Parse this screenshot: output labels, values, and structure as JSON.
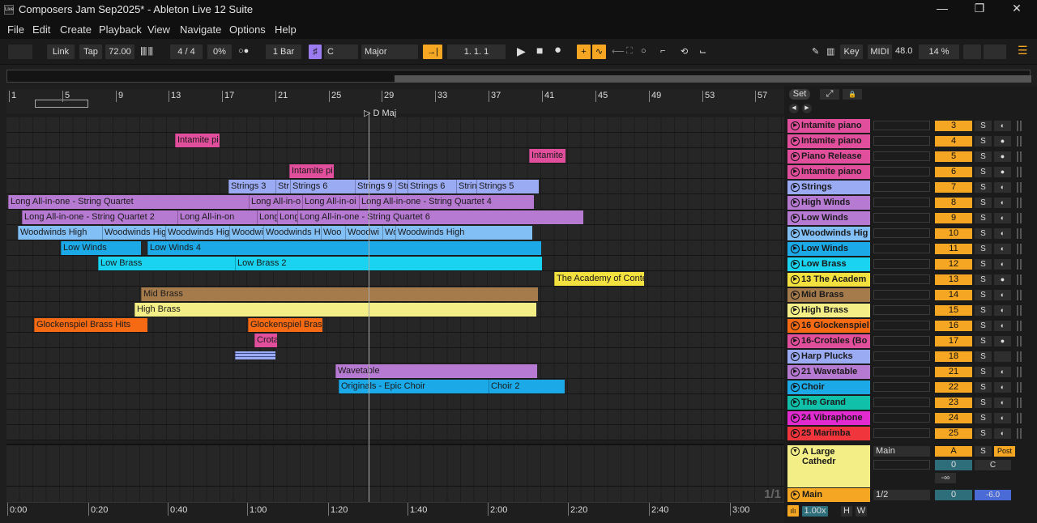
{
  "window": {
    "title": "Composers Jam Sep2025* - Ableton Live 12 Suite",
    "logo": "Live",
    "minimize": "—",
    "restore": "❐",
    "close": "✕"
  },
  "menu": [
    "File",
    "Edit",
    "Create",
    "Playback",
    "View",
    "Navigate",
    "Options",
    "Help"
  ],
  "toolbar": {
    "link": "Link",
    "tap": "Tap",
    "tempo": "72.00",
    "metronome_icon": "||||  |||",
    "time_sig": "4 / 4",
    "groove": "0%",
    "record_mode": "○●",
    "quantize": "1 Bar",
    "scale_root": "C",
    "scale_mode": "Major",
    "follow": "→|",
    "position": "1.   1.   1",
    "play": "▶",
    "stop": "■",
    "record": "●",
    "key": "Key",
    "midi": "MIDI",
    "cpu_value": "48.0",
    "zoom": "14 %"
  },
  "ruler": {
    "bars": [
      "1",
      "5",
      "9",
      "13",
      "17",
      "21",
      "25",
      "29",
      "33",
      "37",
      "41",
      "45",
      "49",
      "53",
      "57"
    ],
    "scale_marker": "D Maj"
  },
  "arrangement_lanes": [
    {
      "clips": []
    },
    {
      "clips": [
        {
          "name": "Intamite pi",
          "color": "#e14f9c"
        }
      ]
    },
    {
      "clips": [
        {
          "name": "Intamite",
          "color": "#e14f9c"
        }
      ]
    },
    {
      "clips": [
        {
          "name": "Intamite pi",
          "color": "#e14f9c"
        }
      ]
    },
    {
      "clips": [
        {
          "name": "Strings 3",
          "color": "#9aaaf3"
        },
        {
          "name": "Str",
          "color": "#9aaaf3"
        },
        {
          "name": "Strings 6",
          "color": "#9aaaf3"
        },
        {
          "name": "Strings 9",
          "color": "#9aaaf3"
        },
        {
          "name": "Str",
          "color": "#9aaaf3"
        },
        {
          "name": "Strings 6",
          "color": "#9aaaf3"
        },
        {
          "name": "Strin",
          "color": "#9aaaf3"
        },
        {
          "name": "Strings 5",
          "color": "#9aaaf3"
        }
      ]
    },
    {
      "clips": [
        {
          "name": "Long All-in-one - String Quartet",
          "color": "#b77ad3"
        },
        {
          "name": "Long All-in-o",
          "color": "#b77ad3"
        },
        {
          "name": "Long All-in-oi",
          "color": "#b77ad3"
        },
        {
          "name": "Long All-in-one - String Quartet 4",
          "color": "#b77ad3"
        }
      ]
    },
    {
      "clips": [
        {
          "name": "Long All-in-one - String Quartet 2",
          "color": "#b77ad3"
        },
        {
          "name": "Long All-in-on",
          "color": "#b77ad3"
        },
        {
          "name": "Long All-i",
          "color": "#b77ad3"
        },
        {
          "name": "Long",
          "color": "#b77ad3"
        },
        {
          "name": "Long All-in-one - String Quartet 6",
          "color": "#b77ad3"
        }
      ]
    },
    {
      "clips": [
        {
          "name": "Woodwinds High",
          "color": "#82bff5"
        },
        {
          "name": "Woodwinds Hig",
          "color": "#82bff5"
        },
        {
          "name": "Woodwinds High",
          "color": "#82bff5"
        },
        {
          "name": "Woodwi",
          "color": "#82bff5"
        },
        {
          "name": "Woodwinds Hi",
          "color": "#82bff5"
        },
        {
          "name": "Woo",
          "color": "#82bff5"
        },
        {
          "name": "Woodwi",
          "color": "#82bff5"
        },
        {
          "name": "Wo",
          "color": "#82bff5"
        },
        {
          "name": "Woodwinds High",
          "color": "#82bff5"
        }
      ]
    },
    {
      "clips": [
        {
          "name": "Low Winds",
          "color": "#1ba9e8"
        },
        {
          "name": "Low Winds 4",
          "color": "#1ba9e8"
        }
      ]
    },
    {
      "clips": [
        {
          "name": "Low Brass",
          "color": "#19d3f0"
        },
        {
          "name": "Low Brass 2",
          "color": "#19d3f0"
        }
      ]
    },
    {
      "clips": [
        {
          "name": "The Academy of Conte",
          "color": "#f3e13f"
        }
      ]
    },
    {
      "clips": [
        {
          "name": "Mid Brass",
          "color": "#a57b4c"
        }
      ]
    },
    {
      "clips": [
        {
          "name": "High Brass",
          "color": "#f3ef86"
        }
      ]
    },
    {
      "clips": [
        {
          "name": "Glockenspiel Brass Hits",
          "color": "#f66a14"
        },
        {
          "name": "Glockenspiel Brass",
          "color": "#f66a14"
        }
      ]
    },
    {
      "clips": [
        {
          "name": "Crota",
          "color": "#e14f9c"
        }
      ]
    },
    {
      "clips": [
        {
          "name": "",
          "color": "#9aaaf3"
        }
      ]
    },
    {
      "clips": [
        {
          "name": "Wavetable",
          "color": "#b77ad3"
        }
      ]
    },
    {
      "clips": [
        {
          "name": "Originals - Epic Choir",
          "color": "#1ba9e8"
        },
        {
          "name": "Choir 2",
          "color": "#1ba9e8"
        }
      ]
    },
    {
      "clips": []
    },
    {
      "clips": []
    },
    {
      "clips": []
    },
    {
      "clips": []
    }
  ],
  "set_controls": {
    "set": "Set",
    "expand": "⤢",
    "lock": "🔒",
    "back": "◀",
    "forward": "▶"
  },
  "tracks": [
    {
      "name": "Intamite piano",
      "color": "#e14f9c",
      "num": "3",
      "solo": "S",
      "arm": "◐"
    },
    {
      "name": "Intamite piano",
      "color": "#e14f9c",
      "num": "4",
      "solo": "S",
      "arm": "●"
    },
    {
      "name": "Piano Release",
      "color": "#e14f9c",
      "num": "5",
      "solo": "S",
      "arm": "●"
    },
    {
      "name": "Intamite piano",
      "color": "#e14f9c",
      "num": "6",
      "solo": "S",
      "arm": "●"
    },
    {
      "name": "Strings",
      "color": "#9aaaf3",
      "num": "7",
      "solo": "S",
      "arm": "◐"
    },
    {
      "name": "High Winds",
      "color": "#b77ad3",
      "num": "8",
      "solo": "S",
      "arm": "◐"
    },
    {
      "name": "Low Winds",
      "color": "#b77ad3",
      "num": "9",
      "solo": "S",
      "arm": "◐"
    },
    {
      "name": "Woodwinds Hig",
      "color": "#82bff5",
      "num": "10",
      "solo": "S",
      "arm": "◐"
    },
    {
      "name": "Low Winds",
      "color": "#1ba9e8",
      "num": "11",
      "solo": "S",
      "arm": "◐"
    },
    {
      "name": "Low Brass",
      "color": "#19d3f0",
      "num": "12",
      "solo": "S",
      "arm": "◐"
    },
    {
      "name": "13 The Academ",
      "color": "#f3e13f",
      "num": "13",
      "solo": "S",
      "arm": "●"
    },
    {
      "name": "Mid Brass",
      "color": "#a57b4c",
      "num": "14",
      "solo": "S",
      "arm": "◐"
    },
    {
      "name": "High Brass",
      "color": "#f3ef86",
      "num": "15",
      "solo": "S",
      "arm": "◐"
    },
    {
      "name": "16 Glockenspiel",
      "color": "#f66a14",
      "num": "16",
      "solo": "S",
      "arm": "◐"
    },
    {
      "name": "16-Crotales (Bo",
      "color": "#e14f9c",
      "num": "17",
      "solo": "S",
      "arm": "●"
    },
    {
      "name": "Harp Plucks",
      "color": "#9aaaf3",
      "num": "18",
      "solo": "S",
      "arm": ""
    },
    {
      "name": "21 Wavetable",
      "color": "#b77ad3",
      "num": "21",
      "solo": "S",
      "arm": "◐"
    },
    {
      "name": "Choir",
      "color": "#1ba9e8",
      "num": "22",
      "solo": "S",
      "arm": "◐"
    },
    {
      "name": "The Grand",
      "color": "#10c0a8",
      "num": "23",
      "solo": "S",
      "arm": "◐"
    },
    {
      "name": "24 Vibraphone",
      "color": "#e12bd0",
      "num": "24",
      "solo": "S",
      "arm": "◐"
    },
    {
      "name": "25 Marimba",
      "color": "#f0363c",
      "num": "25",
      "solo": "S",
      "arm": "◐"
    }
  ],
  "return_track": {
    "name": "A Large Cathedr",
    "color": "#f3ef86",
    "routing": "Main",
    "send_label": "A",
    "solo": "S",
    "post": "Post",
    "volume": "0",
    "pan": "C",
    "send_value": "-∞"
  },
  "main_track": {
    "name": "Main",
    "color": "#f5a623",
    "routing": "1/2",
    "volume": "0",
    "level": "-6.0"
  },
  "footer": {
    "page": "1/1",
    "zoom": "1.00x",
    "h": "H",
    "w": "W"
  },
  "timeline": [
    "0:00",
    "0:20",
    "0:40",
    "1:00",
    "1:20",
    "1:40",
    "2:00",
    "2:20",
    "2:40",
    "3:00"
  ]
}
